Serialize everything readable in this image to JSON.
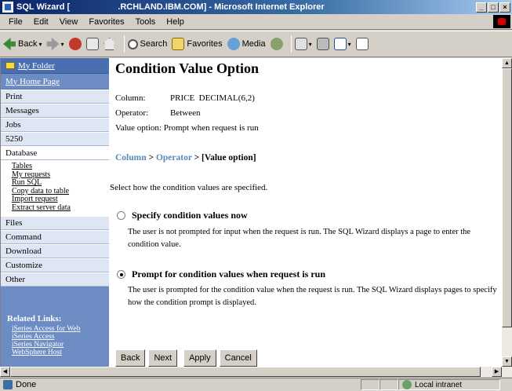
{
  "window": {
    "title": "SQL Wizard [                    .RCHLAND.IBM.COM] - Microsoft Internet Explorer",
    "controls": [
      "_",
      "□",
      "×"
    ]
  },
  "menu": [
    "File",
    "Edit",
    "View",
    "Favorites",
    "Tools",
    "Help"
  ],
  "toolbar": {
    "back": "Back",
    "search": "Search",
    "favorites": "Favorites",
    "media": "Media"
  },
  "sidebar": {
    "my_folder": "My Folder",
    "my_home_page": "My Home Page",
    "nav": [
      "Print",
      "Messages",
      "Jobs",
      "5250",
      "Database"
    ],
    "database_sub": [
      "Tables",
      "My requests",
      "Run SQL",
      "Copy data to table",
      "Import request",
      "Extract server data"
    ],
    "nav2": [
      "Files",
      "Command",
      "Download",
      "Customize",
      "Other"
    ],
    "related_title": "Related Links:",
    "related": [
      "iSeries Access for Web",
      "iSeries Access",
      "iSeries Navigator",
      "WebSphere Host"
    ]
  },
  "main": {
    "title": "Condition Value Option",
    "column_label": "Column:",
    "column_value": "PRICE  DECIMAL(6,2)",
    "operator_label": "Operator:",
    "operator_value": "Between",
    "value_option_text": "Value option: Prompt when request is run",
    "breadcrumb": {
      "column": "Column",
      "sep1": " > ",
      "operator": "Operator",
      "sep2": " > ",
      "current": "[Value option]"
    },
    "instruction": "Select how the condition values are specified.",
    "option1": {
      "label": "Specify condition values now",
      "desc": "The user is not prompted for input when the request is run. The SQL Wizard displays a page to enter the condition value.",
      "selected": false
    },
    "option2": {
      "label": "Prompt for condition values when request is run",
      "desc": "The user is prompted for the condition value when the request is run. The SQL Wizard displays pages to specify how the condition prompt is displayed.",
      "selected": true
    },
    "buttons": {
      "back": "Back",
      "next": "Next",
      "apply": "Apply",
      "cancel": "Cancel"
    }
  },
  "status": {
    "text": "Done",
    "zone": "Local intranet"
  }
}
